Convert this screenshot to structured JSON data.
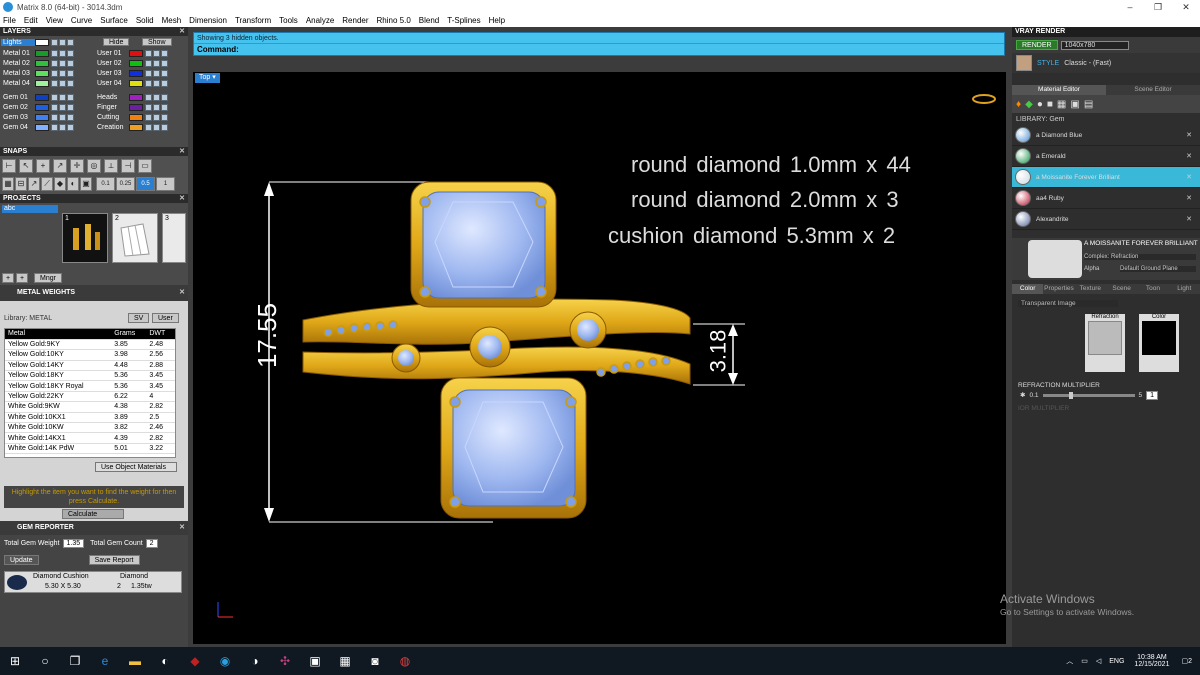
{
  "window": {
    "title": "Matrix 8.0 (64-bit) - 3014.3dm",
    "minimize": "–",
    "maximize": "❐",
    "close": "✕"
  },
  "menu": [
    "File",
    "Edit",
    "View",
    "Curve",
    "Surface",
    "Solid",
    "Mesh",
    "Dimension",
    "Transform",
    "Tools",
    "Analyze",
    "Render",
    "Rhino 5.0",
    "Blend",
    "T-Splines",
    "Help"
  ],
  "layers": {
    "header": "LAYERS",
    "hide_label": "Hide",
    "show_label": "Show",
    "left": [
      {
        "name": "Lights",
        "color": "#ffffff",
        "selected": true
      },
      {
        "name": "Metal 01",
        "color": "#1a9a2a"
      },
      {
        "name": "Metal 02",
        "color": "#30c040"
      },
      {
        "name": "Metal 03",
        "color": "#60e060"
      },
      {
        "name": "Metal 04",
        "color": "#a0f0a0"
      },
      {
        "name": "Gem 01",
        "color": "#1040c0"
      },
      {
        "name": "Gem 02",
        "color": "#2060e0"
      },
      {
        "name": "Gem 03",
        "color": "#4080f0"
      },
      {
        "name": "Gem 04",
        "color": "#80b0ff"
      }
    ],
    "right": [
      {
        "name": "User 01",
        "color": "#e01010"
      },
      {
        "name": "User 02",
        "color": "#10c010"
      },
      {
        "name": "User 03",
        "color": "#1030e0"
      },
      {
        "name": "User 04",
        "color": "#e0e010"
      },
      {
        "name": "Heads",
        "color": "#a020c0"
      },
      {
        "name": "Finger",
        "color": "#6a20a0"
      },
      {
        "name": "Cutting",
        "color": "#f08010"
      },
      {
        "name": "Creation",
        "color": "#f0a020"
      }
    ]
  },
  "snaps": {
    "header": "SNAPS",
    "values": [
      "0.1",
      "0.25",
      "0.5",
      "1"
    ]
  },
  "projects": {
    "header": "PROJECTS",
    "item": "abc",
    "thumb_labels": [
      "1",
      "2",
      "3"
    ],
    "mngr_label": "Mngr"
  },
  "metal_weights": {
    "header": "METAL WEIGHTS",
    "library": "Library: METAL",
    "sv_label": "SV",
    "user_label": "User",
    "columns": [
      "Metal",
      "Grams",
      "DWT"
    ],
    "rows": [
      [
        "Metal",
        "Grams",
        "DWT"
      ],
      [
        "Yellow Gold:9KY",
        "3.85",
        "2.48"
      ],
      [
        "Yellow Gold:10KY",
        "3.98",
        "2.56"
      ],
      [
        "Yellow Gold:14KY",
        "4.48",
        "2.88"
      ],
      [
        "Yellow Gold:18KY",
        "5.36",
        "3.45"
      ],
      [
        "Yellow Gold:18KY Royal",
        "5.36",
        "3.45"
      ],
      [
        "Yellow Gold:22KY",
        "6.22",
        "4"
      ],
      [
        "White Gold:9KW",
        "4.38",
        "2.82"
      ],
      [
        "White Gold:10KX1",
        "3.89",
        "2.5"
      ],
      [
        "White Gold:10KW",
        "3.82",
        "2.46"
      ],
      [
        "White Gold:14KX1",
        "4.39",
        "2.82"
      ],
      [
        "White Gold:14K PdW",
        "5.01",
        "3.22"
      ]
    ],
    "use_object_materials": "Use Object Materials",
    "hint": "Highlight the item you want to find the weight for then press Calculate.",
    "calculate": "Calculate"
  },
  "gem_reporter": {
    "header": "GEM REPORTER",
    "total_weight_label": "Total Gem Weight",
    "total_weight": "1.35",
    "total_count_label": "Total Gem Count",
    "total_count": "2",
    "update": "Update",
    "save_report": "Save Report",
    "gem_name": "Diamond Cushion",
    "gem_type": "Diamond",
    "gem_size": "5.30 X 5.30",
    "gem_qty": "2",
    "gem_ct": "1.35tw"
  },
  "command": {
    "status": "Showing 3 hidden objects.",
    "prompt": "Command:"
  },
  "viewport": {
    "label": "Top",
    "specs": [
      "round diamond 1.0mm x 44",
      "round diamond 2.0mm x 3",
      "cushion diamond 5.3mm x 2"
    ],
    "dim_height": "17.55",
    "dim_band": "3.18"
  },
  "vray": {
    "header": "VRAY RENDER",
    "render": "RENDER",
    "resolution": "1040x780",
    "style_label": "STYLE",
    "style_value": "Classic - (Fast)",
    "tabs": [
      "Material Editor",
      "Scene Editor"
    ],
    "library": "LIBRARY: Gem",
    "materials": [
      {
        "name": "a Diamond Blue",
        "color": "#4f8fd0"
      },
      {
        "name": "a Emerald",
        "color": "#1f9a4f"
      },
      {
        "name": "a Moissanite Forever Brilliant",
        "color": "#c8d8e0",
        "selected": true
      },
      {
        "name": "aa4 Ruby",
        "color": "#c0203a"
      },
      {
        "name": "Alexandrite",
        "color": "#5a6fa0"
      }
    ],
    "preview_title": "A MOISSANITE FOREVER BRILLIANT",
    "complex": "Complex: Refraction",
    "alpha": "Alpha",
    "ground": "Default Ground Plane",
    "subtabs": [
      "Color",
      "Properties",
      "Texture",
      "Scene",
      "Toon",
      "Light"
    ],
    "transparent_image": "Transparent Image",
    "refraction": "Refraction",
    "color": "Color",
    "refraction_multiplier": "REFRACTION MULTIPLIER",
    "rm_min": "0.1",
    "rm_max": "5",
    "rm_value": "1",
    "ior_multiplier": "IOR MULTIPLIER"
  },
  "watermark": {
    "line1": "Activate Windows",
    "line2": "Go to Settings to activate Windows."
  },
  "taskbar": {
    "lang": "ENG",
    "time": "10:38 AM",
    "date": "12/15/2021",
    "notifications": "2"
  }
}
